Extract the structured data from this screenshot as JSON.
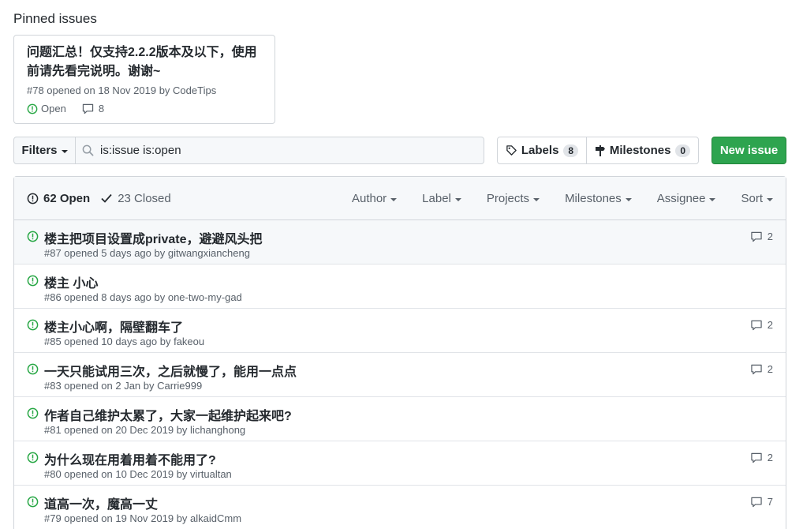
{
  "pinned": {
    "heading": "Pinned issues",
    "card": {
      "title": "问题汇总！仅支持2.2.2版本及以下，使用前请先看完说明。谢谢~",
      "meta": "#78 opened on 18 Nov 2019 by CodeTips",
      "status": "Open",
      "comments": "8"
    }
  },
  "toolbar": {
    "filters_label": "Filters",
    "search_value": "is:issue is:open",
    "labels_label": "Labels",
    "labels_count": "8",
    "milestones_label": "Milestones",
    "milestones_count": "0",
    "new_issue_label": "New issue"
  },
  "header": {
    "open_label": "62 Open",
    "closed_label": "23 Closed",
    "filters": [
      "Author",
      "Label",
      "Projects",
      "Milestones",
      "Assignee",
      "Sort"
    ]
  },
  "issues": [
    {
      "title": "楼主把项目设置成private，避避风头把",
      "meta": "#87 opened 5 days ago by gitwangxiancheng",
      "comments": "2"
    },
    {
      "title": "楼主 小心",
      "meta": "#86 opened 8 days ago by one-two-my-gad",
      "comments": ""
    },
    {
      "title": "楼主小心啊，隔壁翻车了",
      "meta": "#85 opened 10 days ago by fakeou",
      "comments": "2"
    },
    {
      "title": "一天只能试用三次，之后就慢了，能用一点点",
      "meta": "#83 opened on 2 Jan by Carrie999",
      "comments": "2"
    },
    {
      "title": "作者自己维护太累了，大家一起维护起来吧?",
      "meta": "#81 opened on 20 Dec 2019 by lichanghong",
      "comments": ""
    },
    {
      "title": "为什么现在用着用着不能用了?",
      "meta": "#80 opened on 10 Dec 2019 by virtualtan",
      "comments": "2"
    },
    {
      "title": "道高一次，魔高一丈",
      "meta": "#79 opened on 19 Nov 2019 by alkaidCmm",
      "comments": "7"
    }
  ],
  "colors": {
    "open_green": "#28a745",
    "primary_button": "#2ea44f",
    "muted_text": "#586069",
    "border": "#d1d5da"
  }
}
